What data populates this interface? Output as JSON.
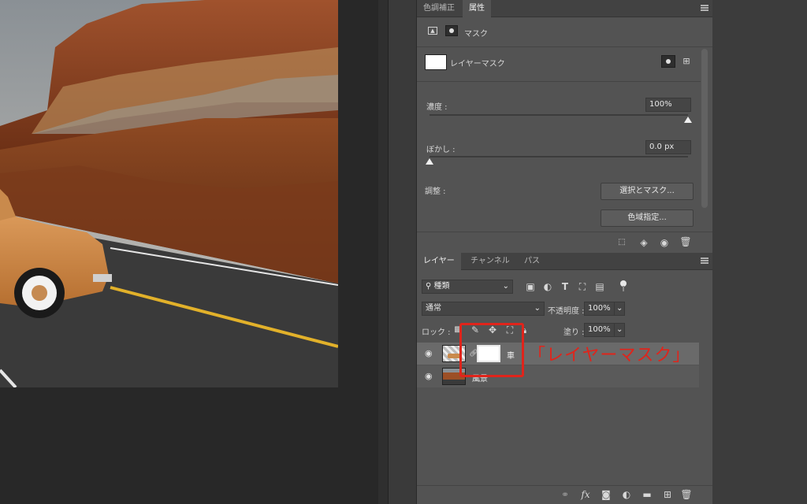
{
  "colors": {
    "accent_red": "#e0241b",
    "panel_bg": "#535353",
    "tab_bg": "#424242"
  },
  "properties_panel": {
    "tabs": [
      "色調補正",
      "属性"
    ],
    "active_tab": "属性",
    "mode_label": "マスク",
    "mask_name": "レイヤーマスク",
    "density_label": "濃度 :",
    "density_value": "100%",
    "density_level_percent": 100,
    "feather_label": "ぼかし :",
    "feather_value": "0.0 px",
    "feather_level_percent": 0,
    "refine_label": "調整 :",
    "select_mask_button": "選択とマスク...",
    "color_range_button": "色域指定..."
  },
  "layers_panel": {
    "tabs": [
      "レイヤー",
      "チャンネル",
      "パス"
    ],
    "active_tab": "レイヤー",
    "filter_kind": "種類",
    "blend_mode": "通常",
    "opacity_label": "不透明度 :",
    "opacity_value": "100%",
    "lock_label": "ロック :",
    "fill_label": "塗り :",
    "fill_value": "100%",
    "layers": [
      {
        "name": "車",
        "selected": true,
        "has_mask": true
      },
      {
        "name": "風景",
        "selected": false,
        "has_mask": false
      }
    ]
  },
  "annotation": {
    "text": "「レイヤーマスク」"
  },
  "footer_icons": [
    "link-icon",
    "fx-icon",
    "mask-icon",
    "adjustment-icon",
    "folder-icon",
    "new-layer-icon",
    "trash-icon"
  ]
}
